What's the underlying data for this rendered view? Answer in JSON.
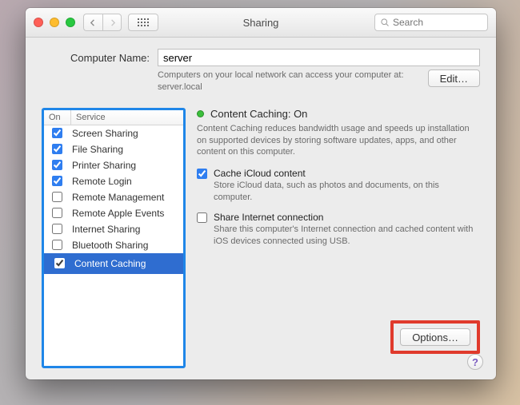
{
  "window": {
    "title": "Sharing",
    "search_placeholder": "Search"
  },
  "computer_name": {
    "label": "Computer Name:",
    "value": "server",
    "hint1": "Computers on your local network can access your computer at:",
    "hint2": "server.local",
    "edit": "Edit…"
  },
  "services": {
    "header_on": "On",
    "header_service": "Service",
    "items": [
      {
        "label": "Screen Sharing",
        "on": true,
        "selected": false
      },
      {
        "label": "File Sharing",
        "on": true,
        "selected": false
      },
      {
        "label": "Printer Sharing",
        "on": true,
        "selected": false
      },
      {
        "label": "Remote Login",
        "on": true,
        "selected": false
      },
      {
        "label": "Remote Management",
        "on": false,
        "selected": false
      },
      {
        "label": "Remote Apple Events",
        "on": false,
        "selected": false
      },
      {
        "label": "Internet Sharing",
        "on": false,
        "selected": false
      },
      {
        "label": "Bluetooth Sharing",
        "on": false,
        "selected": false
      },
      {
        "label": "Content Caching",
        "on": true,
        "selected": true
      }
    ]
  },
  "detail": {
    "status_title": "Content Caching: On",
    "status_desc": "Content Caching reduces bandwidth usage and speeds up installation on supported devices by storing software updates, apps, and other content on this computer.",
    "opt1": {
      "title": "Cache iCloud content",
      "desc": "Store iCloud data, such as photos and documents, on this computer.",
      "checked": true
    },
    "opt2": {
      "title": "Share Internet connection",
      "desc": "Share this computer's Internet connection and cached content with iOS devices connected using USB.",
      "checked": false
    },
    "options_btn": "Options…"
  },
  "help": "?"
}
